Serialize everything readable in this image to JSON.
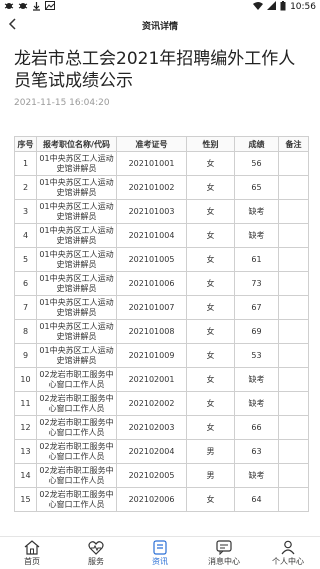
{
  "status_bar": {
    "left_icons": [
      "bug-icon",
      "bug-icon",
      "download-icon",
      "image-icon"
    ],
    "time": "10:56"
  },
  "nav": {
    "title": "资讯详情"
  },
  "article": {
    "title": "龙岩市总工会2021年招聘编外工作人员笔试成绩公示",
    "date": "2021-11-15 16:04:20"
  },
  "table": {
    "headers": [
      "序号",
      "报考职位名称/代码",
      "准考证号",
      "性别",
      "成绩",
      "备注"
    ],
    "rows": [
      [
        "1",
        "01中央苏区工人运动史馆讲解员",
        "202101001",
        "女",
        "56",
        ""
      ],
      [
        "2",
        "01中央苏区工人运动史馆讲解员",
        "202101002",
        "女",
        "65",
        ""
      ],
      [
        "3",
        "01中央苏区工人运动史馆讲解员",
        "202101003",
        "女",
        "缺考",
        ""
      ],
      [
        "4",
        "01中央苏区工人运动史馆讲解员",
        "202101004",
        "女",
        "缺考",
        ""
      ],
      [
        "5",
        "01中央苏区工人运动史馆讲解员",
        "202101005",
        "女",
        "61",
        ""
      ],
      [
        "6",
        "01中央苏区工人运动史馆讲解员",
        "202101006",
        "女",
        "73",
        ""
      ],
      [
        "7",
        "01中央苏区工人运动史馆讲解员",
        "202101007",
        "女",
        "67",
        ""
      ],
      [
        "8",
        "01中央苏区工人运动史馆讲解员",
        "202101008",
        "女",
        "69",
        ""
      ],
      [
        "9",
        "01中央苏区工人运动史馆讲解员",
        "202101009",
        "女",
        "53",
        ""
      ],
      [
        "10",
        "02龙岩市职工服务中心窗口工作人员",
        "202102001",
        "女",
        "缺考",
        ""
      ],
      [
        "11",
        "02龙岩市职工服务中心窗口工作人员",
        "202102002",
        "女",
        "缺考",
        ""
      ],
      [
        "12",
        "02龙岩市职工服务中心窗口工作人员",
        "202102003",
        "女",
        "66",
        ""
      ],
      [
        "13",
        "02龙岩市职工服务中心窗口工作人员",
        "202102004",
        "男",
        "63",
        ""
      ],
      [
        "14",
        "02龙岩市职工服务中心窗口工作人员",
        "202102005",
        "男",
        "缺考",
        ""
      ],
      [
        "15",
        "02龙岩市职工服务中心窗口工作人员",
        "202102006",
        "女",
        "64",
        ""
      ]
    ]
  },
  "tabbar": {
    "items": [
      {
        "label": "首页",
        "icon": "home-icon"
      },
      {
        "label": "服务",
        "icon": "heart-pulse-icon"
      },
      {
        "label": "资讯",
        "icon": "document-icon"
      },
      {
        "label": "消息中心",
        "icon": "message-icon"
      },
      {
        "label": "个人中心",
        "icon": "person-icon"
      }
    ],
    "active_index": 2,
    "active_color": "#2a6fd6"
  }
}
